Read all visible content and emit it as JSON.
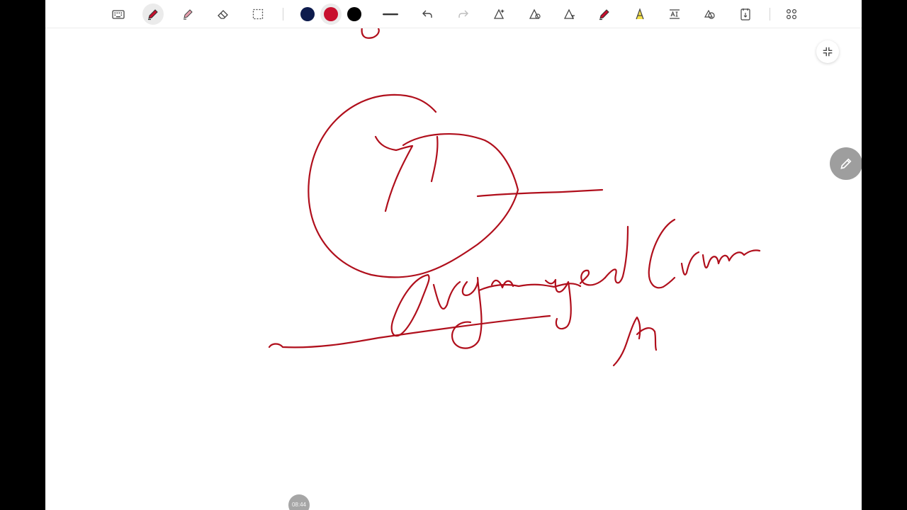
{
  "toolbar": {
    "items": [
      {
        "name": "keyboard-icon"
      },
      {
        "name": "pen-icon",
        "active": true
      },
      {
        "name": "highlighter-icon"
      },
      {
        "name": "eraser-icon"
      },
      {
        "name": "lasso-select-icon"
      },
      {
        "name": "undo-icon"
      },
      {
        "name": "redo-icon",
        "disabled": true
      },
      {
        "name": "shape-recognition-icon"
      },
      {
        "name": "color-picker-icon"
      },
      {
        "name": "text-to-shape-icon"
      },
      {
        "name": "red-pen-icon"
      },
      {
        "name": "text-style-icon"
      },
      {
        "name": "insert-text-icon"
      },
      {
        "name": "shapes-icon"
      },
      {
        "name": "page-insert-icon"
      },
      {
        "name": "more-options-icon"
      }
    ],
    "colors": [
      "#0d1b4d",
      "#c8102e",
      "#000000"
    ],
    "selected_color": "#c8102e",
    "stroke_size": "medium"
  },
  "ink_color": "#b00f1c",
  "status": {
    "time": "08:44"
  }
}
